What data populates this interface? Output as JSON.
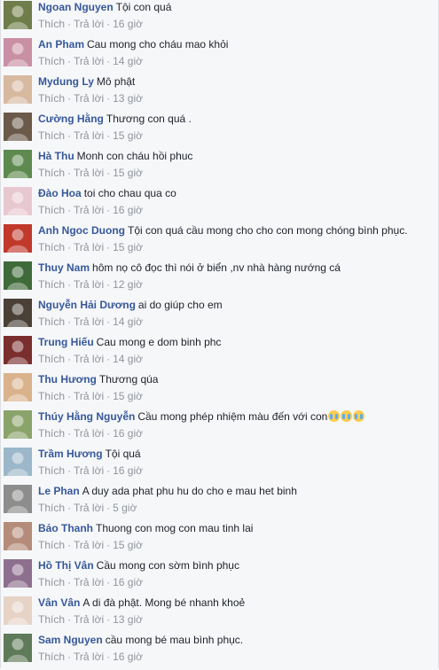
{
  "actions": {
    "like": "Thích",
    "reply": "Trả lời",
    "separator": "·"
  },
  "comments": [
    {
      "name": "Ngoan Nguyen",
      "text": "Tội con quá",
      "time": "16 giờ",
      "avatar_color": "#6f7d4a"
    },
    {
      "name": "An Pham",
      "text": "Cau mong cho cháu mao khỏi",
      "time": "14 giờ",
      "avatar_color": "#c98fa3"
    },
    {
      "name": "Mydung Ly",
      "text": "Mô phật",
      "time": "13 giờ",
      "avatar_color": "#d7b9a0"
    },
    {
      "name": "Cường Hằng",
      "text": "Thương con quá .",
      "time": "15 giờ",
      "avatar_color": "#6b5a4a"
    },
    {
      "name": "Hà Thu",
      "text": "Monh con cháu hồi phuc",
      "time": "15 giờ",
      "avatar_color": "#5e8a4f"
    },
    {
      "name": "Đào Hoa",
      "text": "toi cho chau qua co",
      "time": "16 giờ",
      "avatar_color": "#e8c8d0"
    },
    {
      "name": "Anh Ngoc Duong",
      "text": "Tội con quá cầu mong cho cho con mong chóng bình phục.",
      "time": "15 giờ",
      "avatar_color": "#c0392b"
    },
    {
      "name": "Thuy Nam",
      "text": "hôm nọ cô đọc thì nói ở biển ,nv nhà hàng nướng cá",
      "time": "12 giờ",
      "avatar_color": "#3f6b3a"
    },
    {
      "name": "Nguyễn Hải Dương",
      "text": "ai do giúp cho em",
      "time": "14 giờ",
      "avatar_color": "#4a4036"
    },
    {
      "name": "Trung Hiếu",
      "text": "Cau mong e dom binh phc",
      "time": "14 giờ",
      "avatar_color": "#7a2e2e"
    },
    {
      "name": "Thu Hương",
      "text": "Thương qúa",
      "time": "15 giờ",
      "avatar_color": "#d9b28c"
    },
    {
      "name": "Thúy Hằng Nguyễn",
      "text": "Cầu mong phép nhiệm màu đến với con",
      "emoji_count": 3,
      "time": "16 giờ",
      "avatar_color": "#8aa36a"
    },
    {
      "name": "Trầm Hương",
      "text": "Tội quá",
      "time": "16 giờ",
      "avatar_color": "#9bb7c9"
    },
    {
      "name": "Le Phan",
      "text": "A duy ada phat phu hu do cho e mau het binh",
      "time": "5 giờ",
      "avatar_color": "#8d8d8d"
    },
    {
      "name": "Bảo Thanh",
      "text": "Thuong con mog con mau tinh lai",
      "time": "15 giờ",
      "avatar_color": "#b58c7a"
    },
    {
      "name": "Hồ Thị Vân",
      "text": "Cầu mong con sờm bình phục",
      "time": "16 giờ",
      "avatar_color": "#8e6f8f"
    },
    {
      "name": "Vân Vân",
      "text": "A di đà phật. Mong bé nhanh khoẻ",
      "time": "13 giờ",
      "avatar_color": "#e6d3c6"
    },
    {
      "name": "Sam Nguyen",
      "text": "cầu mong bé mau bình phục.",
      "time": "16 giờ",
      "avatar_color": "#5f7a58"
    }
  ]
}
